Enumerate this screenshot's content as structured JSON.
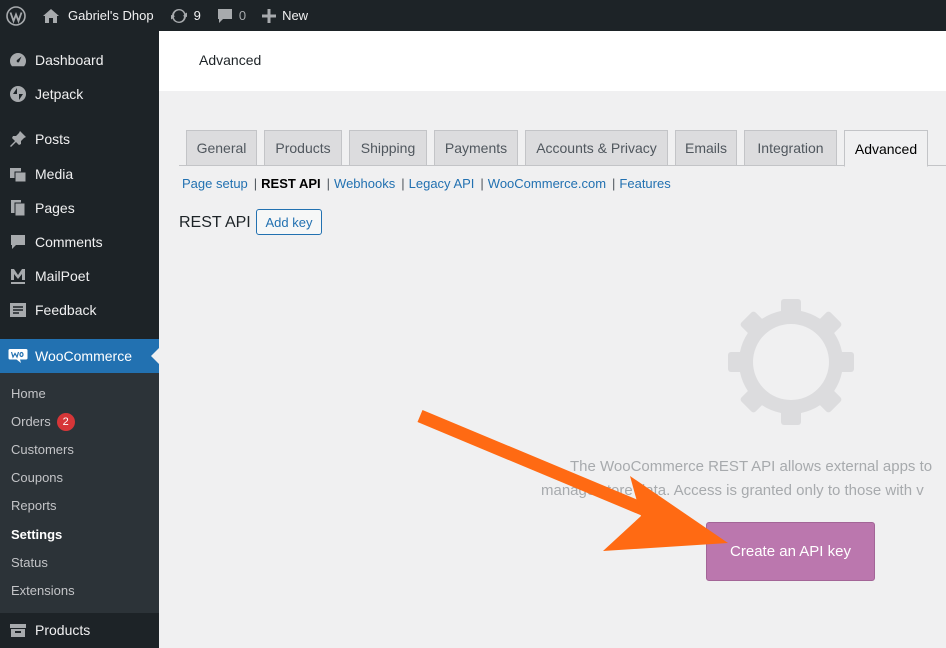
{
  "admin_bar": {
    "site_name": "Gabriel's Dhop",
    "updates_count": "9",
    "comments_count": "0",
    "new_label": "New",
    "icons": [
      "wordpress-logo-icon",
      "home-icon",
      "updates-icon",
      "comment-icon",
      "plus-icon"
    ]
  },
  "sidebar": {
    "items": [
      {
        "label": "Dashboard",
        "icon": "dashboard-icon"
      },
      {
        "label": "Jetpack",
        "icon": "jetpack-icon"
      },
      {
        "label": "Posts",
        "icon": "pin-icon"
      },
      {
        "label": "Media",
        "icon": "media-icon"
      },
      {
        "label": "Pages",
        "icon": "pages-icon"
      },
      {
        "label": "Comments",
        "icon": "comment-icon"
      },
      {
        "label": "MailPoet",
        "icon": "mailpoet-icon"
      },
      {
        "label": "Feedback",
        "icon": "feedback-icon"
      },
      {
        "label": "WooCommerce",
        "icon": "woo-icon"
      },
      {
        "label": "Products",
        "icon": "products-icon"
      }
    ],
    "submenu": [
      {
        "label": "Home"
      },
      {
        "label": "Orders",
        "badge": "2"
      },
      {
        "label": "Customers"
      },
      {
        "label": "Coupons"
      },
      {
        "label": "Reports"
      },
      {
        "label": "Settings"
      },
      {
        "label": "Status"
      },
      {
        "label": "Extensions"
      }
    ]
  },
  "header": {
    "title": "Advanced"
  },
  "tabs": [
    "General",
    "Products",
    "Shipping",
    "Payments",
    "Accounts & Privacy",
    "Emails",
    "Integration",
    "Advanced"
  ],
  "active_tab": "Advanced",
  "sections": [
    "Page setup",
    "REST API",
    "Webhooks",
    "Legacy API",
    "WooCommerce.com",
    "Features"
  ],
  "active_section": "REST API",
  "rest_api": {
    "title": "REST API",
    "add_key_label": "Add key",
    "blank_line1": "The WooCommerce REST API allows external apps to",
    "blank_line2": "manage store data. Access is granted only to those with v",
    "create_key_label": "Create an API key"
  },
  "colors": {
    "admin_dark": "#1d2327",
    "accent_blue": "#2271b1",
    "woo_purple": "#bb77ae",
    "annotation_arrow": "#ff6a13"
  }
}
